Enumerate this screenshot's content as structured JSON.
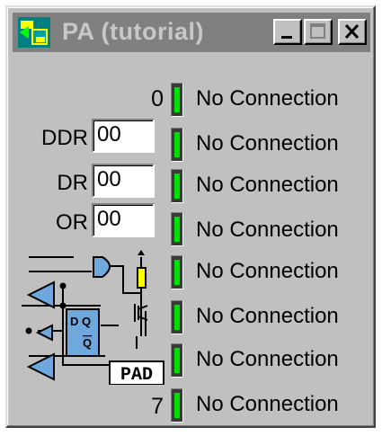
{
  "window": {
    "title": "PA (tutorial)",
    "icons": {
      "app": "io-port-icon",
      "minimize": "minimize-icon",
      "maximize": "maximize-icon",
      "close": "close-icon"
    }
  },
  "bits": {
    "first": "0",
    "last": "7"
  },
  "registers": [
    {
      "label": "DDR",
      "value": "00"
    },
    {
      "label": "DR",
      "value": "00"
    },
    {
      "label": "OR",
      "value": "00"
    }
  ],
  "pins": [
    {
      "status": "No Connection",
      "led": "on"
    },
    {
      "status": "No Connection",
      "led": "on"
    },
    {
      "status": "No Connection",
      "led": "on"
    },
    {
      "status": "No Connection",
      "led": "on"
    },
    {
      "status": "No Connection",
      "led": "on"
    },
    {
      "status": "No Connection",
      "led": "on"
    },
    {
      "status": "No Connection",
      "led": "on"
    },
    {
      "status": "No Connection",
      "led": "on"
    }
  ],
  "schematic": {
    "pad_label": "PAD",
    "dq_top": "D Q",
    "dq_bottom": "Q"
  },
  "colors": {
    "led_on": "#00e000",
    "schematic_fill": "#6ea8dc"
  }
}
